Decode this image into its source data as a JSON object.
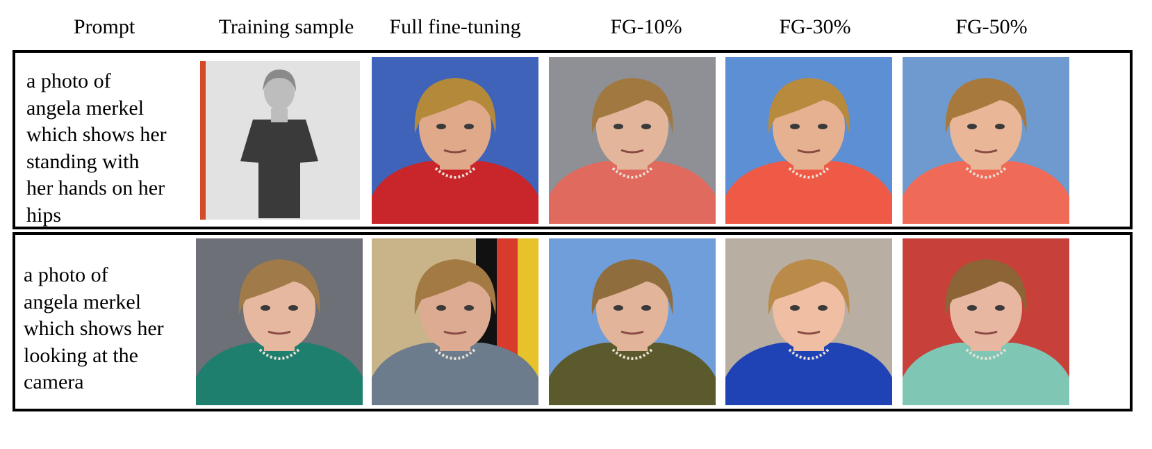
{
  "headers": [
    "Prompt",
    "Training sample",
    "Full fine-tuning",
    "FG-10%",
    "FG-30%",
    "FG-50%"
  ],
  "rows": [
    {
      "prompt_lines": [
        "a photo of",
        "angela merkel",
        "which shows her",
        "standing with",
        "her hands on her",
        "hips"
      ],
      "images": [
        {
          "label": "training-sample",
          "bg": "#e6e6e6",
          "jacket": "#3a3a3a",
          "skin": "#bdbdbd",
          "hair": "#8a8a8a",
          "framed": true
        },
        {
          "label": "full-fine-tuning",
          "bg": "#3e63b8",
          "jacket": "#c8262a",
          "skin": "#e0a98a",
          "hair": "#b48a3a"
        },
        {
          "label": "fg-10",
          "bg": "#8e9096",
          "jacket": "#e06a5e",
          "skin": "#e3b69c",
          "hair": "#a07840"
        },
        {
          "label": "fg-30",
          "bg": "#5d8fd4",
          "jacket": "#ee5a45",
          "skin": "#e6b191",
          "hair": "#b88a3e"
        },
        {
          "label": "fg-50",
          "bg": "#6f9ad0",
          "jacket": "#f06a58",
          "skin": "#e9b697",
          "hair": "#a8793c"
        }
      ]
    },
    {
      "prompt_lines": [
        "a photo of",
        "angela merkel",
        "which shows her",
        "looking at the",
        "camera"
      ],
      "images": [
        {
          "label": "training-sample",
          "bg": "#6d7077",
          "jacket": "#1f7f6e",
          "skin": "#e6b8a0",
          "hair": "#a07a48"
        },
        {
          "label": "full-fine-tuning",
          "bg": "#c9b48a",
          "jacket": "#6d7c8d",
          "skin": "#dcab92",
          "hair": "#a47a44",
          "flag": true
        },
        {
          "label": "fg-10",
          "bg": "#6f9edb",
          "jacket": "#5b5a2c",
          "skin": "#e2b49a",
          "hair": "#8f6d3c"
        },
        {
          "label": "fg-30",
          "bg": "#b8aea2",
          "jacket": "#1f43b4",
          "skin": "#efbea3",
          "hair": "#b98a48"
        },
        {
          "label": "fg-50",
          "bg": "#c8403a",
          "jacket": "#7fc6b4",
          "skin": "#e8b7a2",
          "hair": "#8c6436"
        }
      ]
    }
  ]
}
